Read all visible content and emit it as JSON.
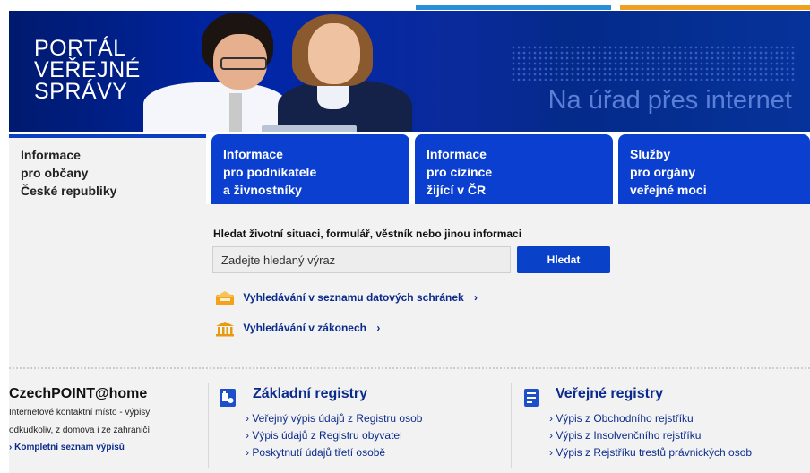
{
  "banner": {
    "logo_lines": [
      "PORTÁL",
      "VEŘEJNÉ",
      "SPRÁVY"
    ],
    "slogan": "Na úřad přes internet"
  },
  "tabs": [
    {
      "lines": [
        "Informace",
        "pro občany",
        "České republiky"
      ],
      "active": true
    },
    {
      "lines": [
        "Informace",
        "pro podnikatele",
        "a živnostníky"
      ],
      "active": false
    },
    {
      "lines": [
        "Informace",
        "pro cizince",
        "žijící v ČR"
      ],
      "active": false
    },
    {
      "lines": [
        "Služby",
        "pro orgány",
        "veřejné moci"
      ],
      "active": false
    }
  ],
  "search": {
    "label": "Hledat životní situaci, formulář, věstník nebo jinou informaci",
    "placeholder": "Zadejte hledaný výraz",
    "button": "Hledat"
  },
  "quick_links": [
    {
      "label": "Vyhledávání v seznamu datových schránek",
      "chevron": "›",
      "icon": "mailbox-icon"
    },
    {
      "label": "Vyhledávání v zákonech",
      "chevron": "›",
      "icon": "courthouse-icon"
    }
  ],
  "czechpoint": {
    "title": "CzechPOINT@home",
    "desc_lines": [
      "Internetové kontaktní místo - výpisy",
      "odkudkoliv, z domova i ze zahraničí."
    ],
    "link": "› Kompletní seznam výpisů"
  },
  "zakladni": {
    "title": "Základní registry",
    "items": [
      "› Veřejný výpis údajů z Registru osob",
      "› Výpis údajů z Registru obyvatel",
      "› Poskytnutí údajů třetí osobě"
    ]
  },
  "verejne": {
    "title": "Veřejné registry",
    "items": [
      "› Výpis z Obchodního rejstříku",
      "› Výpis z Insolvenčního rejstříku",
      "› Výpis z Rejstříku trestů právnických osob"
    ]
  },
  "colors": {
    "accent_blue": "#0b3fd0",
    "link_blue": "#0a2a8c",
    "orange": "#f0a020"
  }
}
